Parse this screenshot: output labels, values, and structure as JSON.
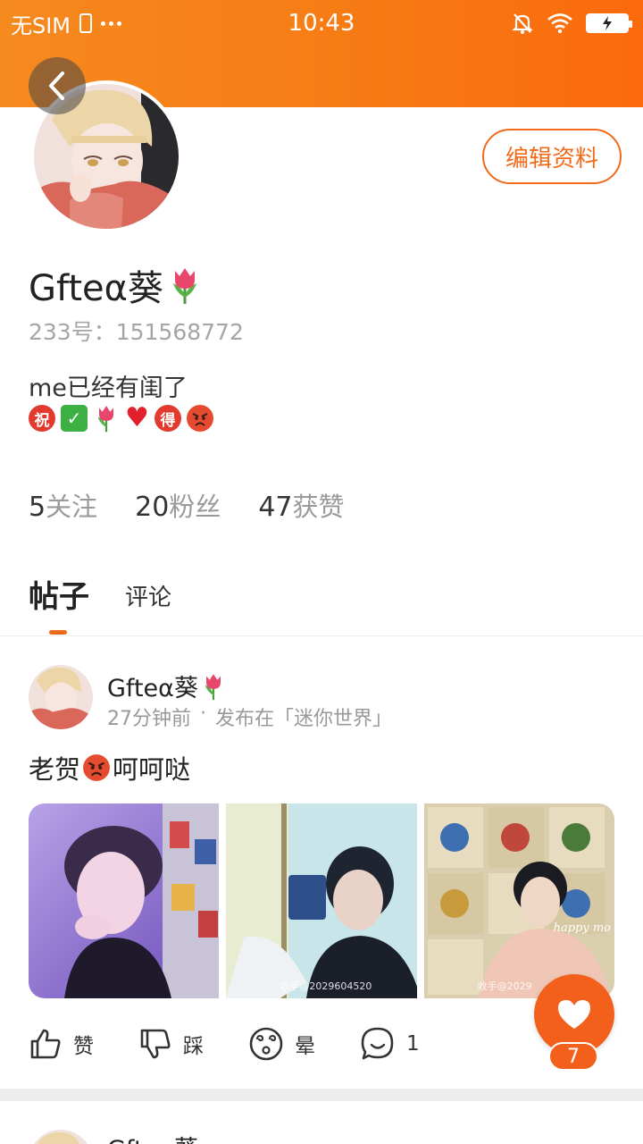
{
  "status_bar": {
    "carrier": "无SIM",
    "time": "10:43"
  },
  "profile": {
    "edit_button": "编辑资料",
    "name": "Gfteα葵",
    "id_label": "233号：151568772",
    "bio": "me已经有闺了",
    "bio_emojis": [
      "祝",
      "check",
      "tulip",
      "heart",
      "得",
      "angry-face"
    ]
  },
  "stats": [
    {
      "count": "5",
      "label": "关注"
    },
    {
      "count": "20",
      "label": "粉丝"
    },
    {
      "count": "47",
      "label": "获赞"
    }
  ],
  "tabs": [
    {
      "label": "帖子",
      "active": true
    },
    {
      "label": "评论",
      "active": false
    }
  ],
  "post": {
    "author": "Gfteα葵",
    "time": "27分钟前",
    "published_in": "发布在「迷你世界」",
    "text": "老贺",
    "text_suffix": "呵呵哒",
    "images": [
      {
        "watermark": ""
      },
      {
        "watermark": "收手@2029604520"
      },
      {
        "watermark": "收手@2029"
      }
    ],
    "image_overlay_text": "happy mo",
    "actions": [
      {
        "icon": "thumbs-up-icon",
        "label": "赞"
      },
      {
        "icon": "thumbs-down-icon",
        "label": "踩"
      },
      {
        "icon": "dizzy-face-icon",
        "label": "晕"
      },
      {
        "icon": "comment-icon",
        "label": "1"
      }
    ]
  },
  "fab": {
    "icon": "heart-icon",
    "count": "7"
  },
  "next_post": {
    "author": "Gfteα葵"
  },
  "colors": {
    "accent": "#f06a1a",
    "header_gradient_start": "#f58a1f",
    "header_gradient_end": "#fb6a0c"
  }
}
